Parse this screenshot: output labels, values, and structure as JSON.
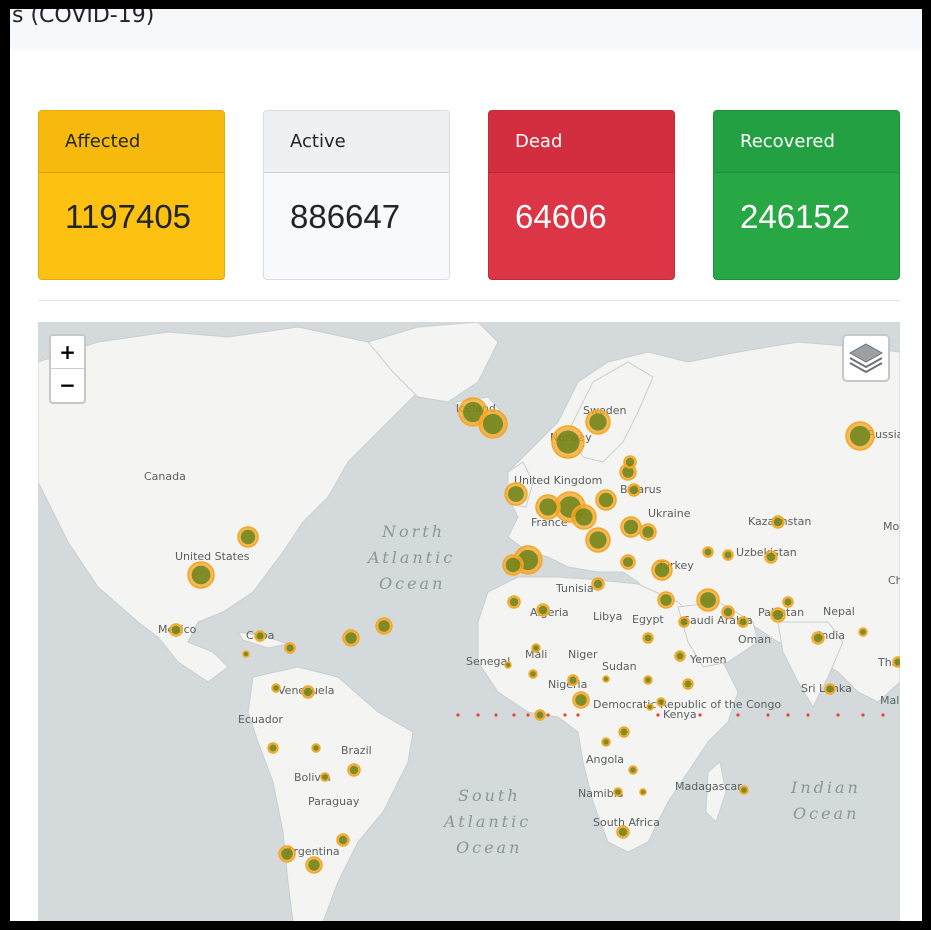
{
  "header": {
    "title": "s (COVID-19)"
  },
  "stats": [
    {
      "key": "affected",
      "label": "Affected",
      "value": "1197405"
    },
    {
      "key": "active",
      "label": "Active",
      "value": "886647"
    },
    {
      "key": "dead",
      "label": "Dead",
      "value": "64606"
    },
    {
      "key": "recovered",
      "label": "Recovered",
      "value": "246152"
    }
  ],
  "map": {
    "zoom_in": "+",
    "zoom_out": "−",
    "layers_icon": "layers-icon",
    "place_labels": [
      "Canada",
      "United States",
      "Mexico",
      "Cuba",
      "Venezuela",
      "Ecuador",
      "Brazil",
      "Bolivia",
      "Paraguay",
      "Argentina",
      "United Kingdom",
      "France",
      "Iceland",
      "Norway",
      "Sweden",
      "Belarus",
      "Ukraine",
      "Russia",
      "Kazakhstan",
      "Uzbekistan",
      "Turkey",
      "Tunisia",
      "Algeria",
      "Libya",
      "Egypt",
      "Saudi Arabia",
      "Oman",
      "Yemen",
      "Pakistan",
      "Nepal",
      "India",
      "Sri Lanka",
      "Sudan",
      "Mali",
      "Niger",
      "Senegal",
      "Nigeria",
      "Democratic Republic of the Congo",
      "Kenya",
      "Angola",
      "Namibia",
      "South Africa",
      "Madagascar",
      "Mo",
      "Ch",
      "Tha",
      "Mal"
    ],
    "ocean_labels": [
      "North Atlantic Ocean",
      "South Atlantic Ocean",
      "Indian Ocean"
    ],
    "colors": {
      "water": "#d4dadc",
      "land": "#f4f4f2",
      "marker_fill": "#f6a623",
      "marker_core": "#4f7a12",
      "marker_red": "#e8442a"
    }
  }
}
